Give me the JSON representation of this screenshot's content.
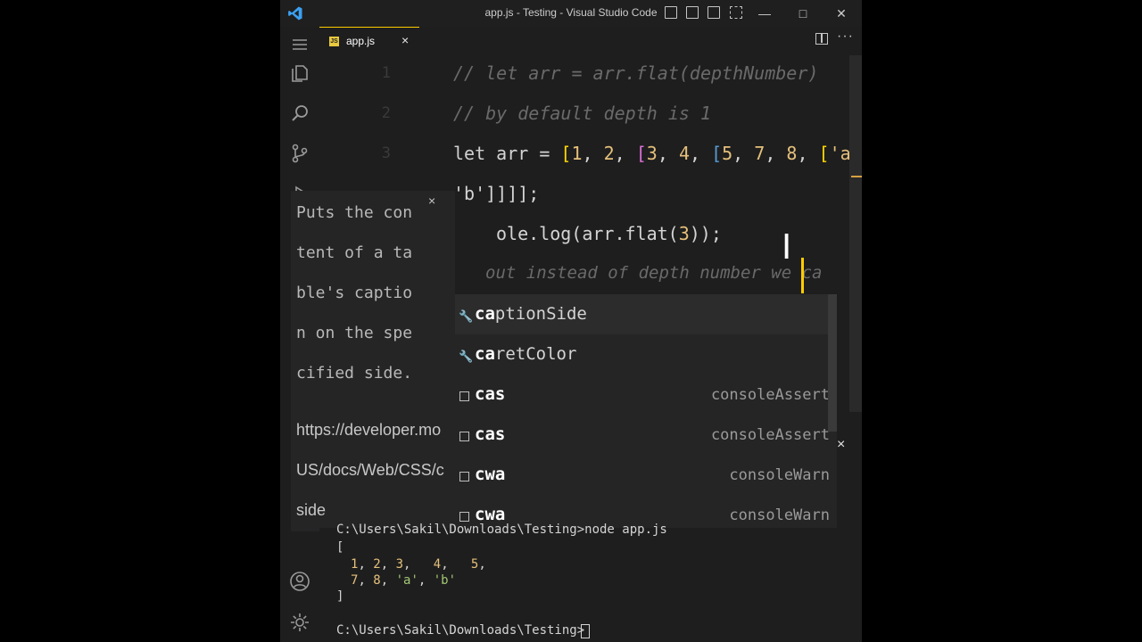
{
  "window": {
    "title": "app.js - Testing - Visual Studio Code"
  },
  "tab": {
    "js_badge": "JS",
    "label": "app.js",
    "close": "×"
  },
  "toolbar": {
    "more": "···"
  },
  "editor": {
    "gutter": [
      "1",
      "2",
      "3"
    ],
    "lines": {
      "l1": "// let arr = arr.flat(depthNumber)",
      "l2": "// by default depth is 1",
      "l3_kw": "let",
      "l3_id": " arr = ",
      "l3_b1": "[",
      "l3_n1": "1",
      "l3_s1": ", ",
      "l3_n2": "2",
      "l3_s2": ", ",
      "l3_b2": "[",
      "l3_n3": "3",
      "l3_s3": ", ",
      "l3_n4": "4",
      "l3_s4": ", ",
      "l3_b3": "[",
      "l3_n5": "5",
      "l3_s5": ", ",
      "l3_n6": "7",
      "l3_s6": ", ",
      "l3_n7": "8",
      "l3_s7": ", ",
      "l3_b4": "[",
      "l3_str": "'a'",
      "l3_s8": ",",
      "l4": "'b']]]];",
      "l5_a": "ole.log(arr.flat(",
      "l5_n": "3",
      "l5_b": "));",
      "l6": "out instead of depth number we ca"
    }
  },
  "doc_hover": {
    "text_lines": [
      "Puts the con",
      "tent of a ta",
      "ble's captio",
      "n on the spe",
      "cified side."
    ],
    "link_lines": [
      "https://developer.mo",
      "US/docs/Web/CSS/c",
      "side"
    ],
    "close": "×"
  },
  "suggestions": [
    {
      "match": "ca",
      "rest": "ptionSide",
      "detail": "",
      "kind": "property"
    },
    {
      "match": "ca",
      "rest": "retColor",
      "detail": "",
      "kind": "property"
    },
    {
      "match": "cas",
      "rest": "",
      "detail": "consoleAssert",
      "kind": "snippet"
    },
    {
      "match": "cas",
      "rest": "",
      "detail": "consoleAssert",
      "kind": "snippet"
    },
    {
      "match": "cwa",
      "rest": "",
      "detail": "consoleWarn",
      "kind": "snippet"
    },
    {
      "match": "cwa",
      "rest": "",
      "detail": "consoleWarn",
      "kind": "snippet"
    }
  ],
  "suggest_close": "×",
  "terminal": {
    "cmd": "C:\\Users\\Sakil\\Downloads\\Testing>node app.js",
    "open": "[",
    "row1": [
      "1",
      "2",
      "3",
      "4",
      "5"
    ],
    "row2_nums": [
      "7",
      "8"
    ],
    "row2_strs": [
      "'a'",
      "'b'"
    ],
    "close": "]",
    "prompt": "C:\\Users\\Sakil\\Downloads\\Testing>"
  },
  "colors": {
    "accent": "#ffcc00",
    "editor_bg": "#1e1e1e",
    "widget_bg": "#252526",
    "number": "#e5c07b"
  }
}
